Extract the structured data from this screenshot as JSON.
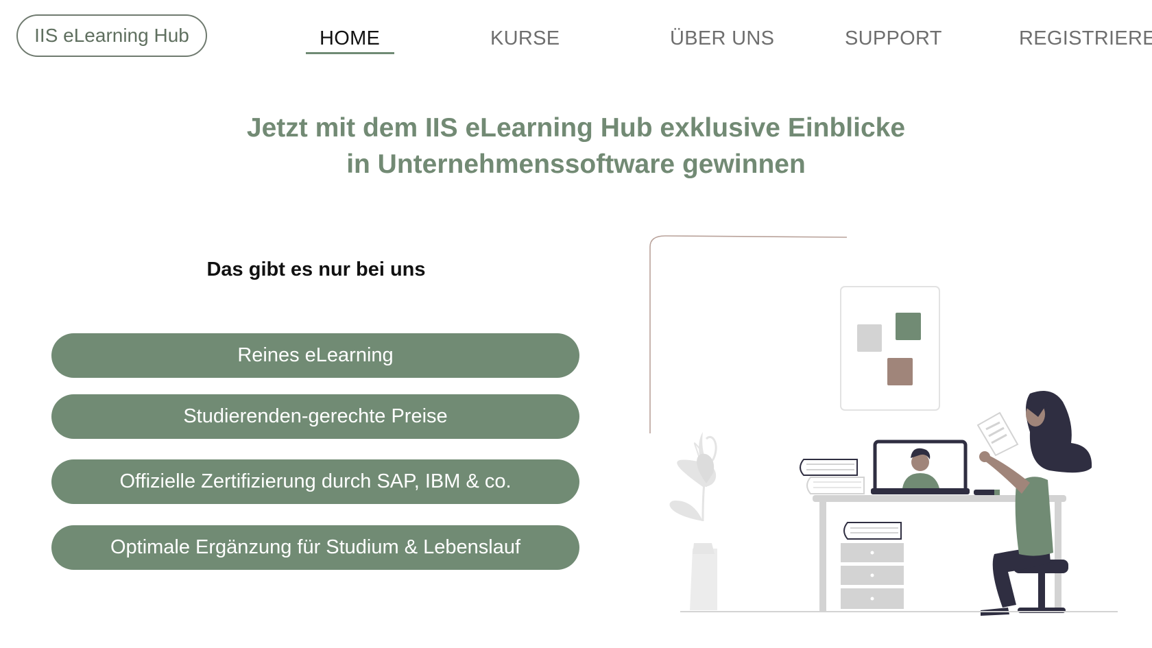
{
  "header": {
    "logo_text": "IIS eLearning Hub",
    "nav": [
      {
        "label": "HOME",
        "active": true
      },
      {
        "label": "KURSE",
        "active": false
      },
      {
        "label": "ÜBER UNS",
        "active": false
      },
      {
        "label": "SUPPORT",
        "active": false
      },
      {
        "label": "REGISTRIEREN",
        "active": false
      }
    ]
  },
  "hero": {
    "headline_line1": "Jetzt mit dem IIS eLearning Hub exklusive Einblicke",
    "headline_line2": "in Unternehmenssoftware gewinnen"
  },
  "features": {
    "heading": "Das gibt es nur bei uns",
    "items": [
      "Reines eLearning",
      "Studierenden-gerechte Preise",
      "Offizielle Zertifizierung durch SAP, IBM & co.",
      "Optimale Ergänzung für Studium & Lebenslauf"
    ]
  },
  "colors": {
    "accent": "#718b74",
    "text_dark": "#111111",
    "nav_text": "#6e6e6e",
    "illustration_dark": "#2f2e41",
    "illustration_brown": "#a0857a",
    "illustration_gray": "#cfcfcf"
  },
  "illustration": {
    "name": "online-learning-illustration"
  }
}
